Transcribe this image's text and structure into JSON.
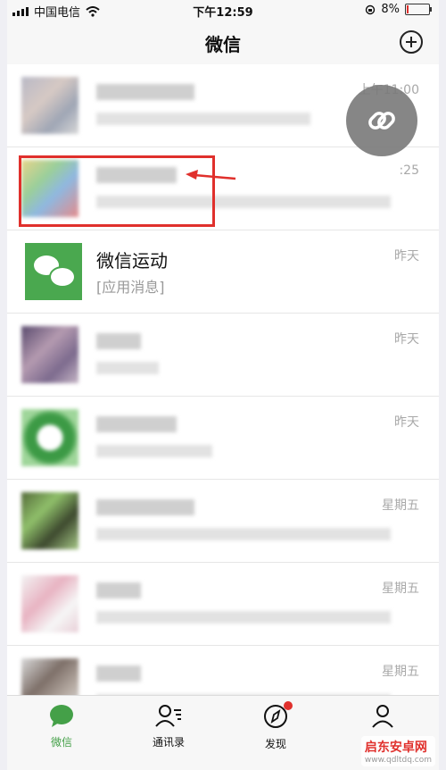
{
  "status_bar": {
    "carrier": "中国电信",
    "time": "下午12:59",
    "battery_text": "8%",
    "battery_fraction": 0.08
  },
  "nav": {
    "title": "微信"
  },
  "chats": [
    {
      "time": "上午11:00"
    },
    {
      "time": ":25"
    },
    {
      "name": "微信运动",
      "message": "[应用消息]",
      "time": "昨天"
    },
    {
      "time": "昨天"
    },
    {
      "time": "昨天"
    },
    {
      "time": "星期五"
    },
    {
      "time": "星期五"
    },
    {
      "time": "星期五"
    }
  ],
  "tabs": [
    {
      "label": "微信",
      "icon": "chat-bubble-icon"
    },
    {
      "label": "通讯录",
      "icon": "contacts-icon"
    },
    {
      "label": "发现",
      "icon": "compass-icon"
    },
    {
      "label": "",
      "icon": "me-icon"
    }
  ],
  "watermark": {
    "title": "启东安卓网",
    "url": "www.qdltdq.com"
  },
  "colors": {
    "accent": "#44a048",
    "highlight": "#e0302c"
  }
}
